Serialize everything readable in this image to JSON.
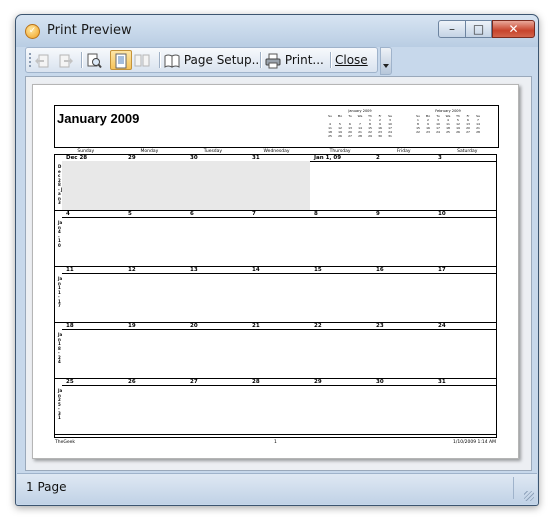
{
  "window": {
    "title": "Print Preview",
    "minimize_symbol": "–",
    "maximize_symbol": "□",
    "close_symbol": "✕",
    "accent": "#c7432b"
  },
  "toolbar": {
    "items": [
      {
        "name": "prev-page",
        "icon": "page-back-icon",
        "enabled": false
      },
      {
        "name": "next-page",
        "icon": "page-forward-icon",
        "enabled": false
      },
      {
        "name": "zoom",
        "icon": "zoom-page-icon",
        "enabled": true
      },
      {
        "name": "one-page",
        "icon": "one-page-icon",
        "active": true
      },
      {
        "name": "two-pages",
        "icon": "two-pages-icon",
        "enabled": false
      }
    ],
    "page_setup_label": "Page Setup...",
    "print_label": "Print...",
    "close_label": "Close"
  },
  "calendar": {
    "title": "January 2009",
    "mini_jan": {
      "title": "January 2009",
      "days": [
        "Su",
        "Mo",
        "Tu",
        "We",
        "Th",
        "Fr",
        "Sa"
      ],
      "rows": [
        [
          "",
          "",
          "",
          "",
          "1",
          "2",
          "3"
        ],
        [
          "4",
          "5",
          "6",
          "7",
          "8",
          "9",
          "10"
        ],
        [
          "11",
          "12",
          "13",
          "14",
          "15",
          "16",
          "17"
        ],
        [
          "18",
          "19",
          "20",
          "21",
          "22",
          "23",
          "24"
        ],
        [
          "25",
          "26",
          "27",
          "28",
          "29",
          "30",
          "31"
        ]
      ]
    },
    "mini_feb": {
      "title": "February 2009",
      "days": [
        "Su",
        "Mo",
        "Tu",
        "We",
        "Th",
        "Fr",
        "Sa"
      ],
      "rows": [
        [
          "1",
          "2",
          "3",
          "4",
          "5",
          "6",
          "7"
        ],
        [
          "8",
          "9",
          "10",
          "11",
          "12",
          "13",
          "14"
        ],
        [
          "15",
          "16",
          "17",
          "18",
          "19",
          "20",
          "21"
        ],
        [
          "22",
          "23",
          "24",
          "25",
          "26",
          "27",
          "28"
        ]
      ]
    },
    "day_names": [
      "Sunday",
      "Monday",
      "Tuesday",
      "Wednesday",
      "Thursday",
      "Friday",
      "Saturday"
    ],
    "weeks": [
      {
        "range": "Dec 28 - Jan 3",
        "days": [
          "Dec 28",
          "29",
          "30",
          "31",
          "Jan 1, 09",
          "2",
          "3"
        ],
        "shaded": [
          true,
          true,
          true,
          true,
          false,
          false,
          false
        ]
      },
      {
        "range": "Jan 4 - 10",
        "days": [
          "4",
          "5",
          "6",
          "7",
          "8",
          "9",
          "10"
        ],
        "shaded": [
          false,
          false,
          false,
          false,
          false,
          false,
          false
        ]
      },
      {
        "range": "Jan 11 - 17",
        "days": [
          "11",
          "12",
          "13",
          "14",
          "15",
          "16",
          "17"
        ],
        "shaded": [
          false,
          false,
          false,
          false,
          false,
          false,
          false
        ]
      },
      {
        "range": "Jan 18 - 24",
        "days": [
          "18",
          "19",
          "20",
          "21",
          "22",
          "23",
          "24"
        ],
        "shaded": [
          false,
          false,
          false,
          false,
          false,
          false,
          false
        ]
      },
      {
        "range": "Jan 25 - 31",
        "days": [
          "25",
          "26",
          "27",
          "28",
          "29",
          "30",
          "31"
        ],
        "shaded": [
          false,
          false,
          false,
          false,
          false,
          false,
          false
        ]
      }
    ],
    "footer_left": "TheGeek",
    "footer_mid": "1",
    "footer_right": "1/10/2009 1:14 AM"
  },
  "status": {
    "text": "1 Page"
  }
}
